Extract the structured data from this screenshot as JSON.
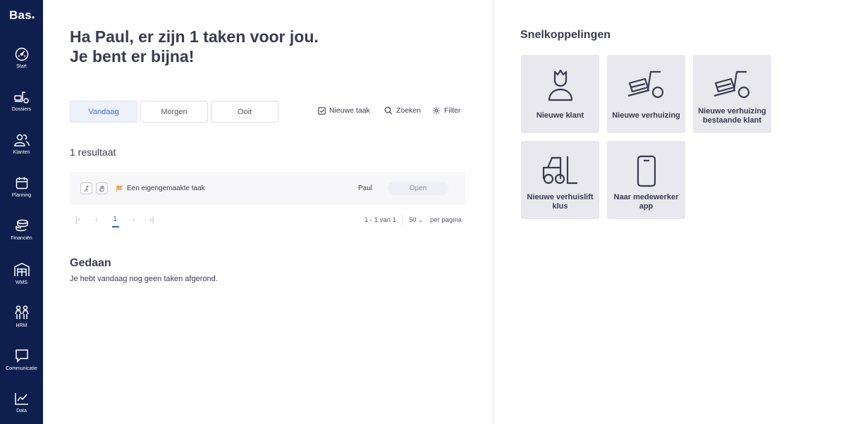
{
  "app": {
    "logo": "Bas",
    "colors": {
      "sidebar": "#0f1f4d",
      "accent": "#2f5fd0",
      "flag": "#f5a55c"
    }
  },
  "sidebar": {
    "items": [
      {
        "label": "Start",
        "icon": "gauge-icon"
      },
      {
        "label": "Dossiers",
        "icon": "moving-truck-icon"
      },
      {
        "label": "Klanten",
        "icon": "customers-icon"
      },
      {
        "label": "Planning",
        "icon": "calendar-icon"
      },
      {
        "label": "Financiën",
        "icon": "coins-icon"
      },
      {
        "label": "WMS",
        "icon": "warehouse-icon"
      },
      {
        "label": "HRM",
        "icon": "people-icon"
      },
      {
        "label": "Communicatie",
        "icon": "chat-icon"
      },
      {
        "label": "Data",
        "icon": "line-chart-icon"
      }
    ]
  },
  "main": {
    "greeting": "Ha Paul, er zijn 1 taken voor jou. Je bent er bijna!",
    "tabs": [
      {
        "label": "Vandaag",
        "active": true
      },
      {
        "label": "Morgen",
        "active": false
      },
      {
        "label": "Ooit",
        "active": false
      }
    ],
    "actions": {
      "new_task": "Nieuwe taak",
      "search": "Zoeken",
      "filter": "Filter"
    },
    "result_count": "1 resultaat",
    "tasks": [
      {
        "name": "Een eigengemaakte taak",
        "user": "Paul",
        "status": "Open"
      }
    ],
    "pagination": {
      "current_page": "1",
      "range": "1 - 1 van 1",
      "page_size": "50",
      "per_page_label": "per pagina"
    },
    "done": {
      "title": "Gedaan",
      "text": "Je hebt vandaag nog geen taken afgerond."
    }
  },
  "quick_links": {
    "title": "Snelkoppelingen",
    "cards": [
      {
        "label": "Nieuwe klant",
        "icon": "new-customer-icon"
      },
      {
        "label": "Nieuwe verhuizing",
        "icon": "moving-dolly-icon"
      },
      {
        "label": "Nieuwe verhuizing bestaande klant",
        "icon": "moving-dolly-icon"
      },
      {
        "label": "Nieuwe verhuislift klus",
        "icon": "forklift-icon"
      },
      {
        "label": "Naar medewerker app",
        "icon": "smartphone-icon"
      }
    ]
  }
}
